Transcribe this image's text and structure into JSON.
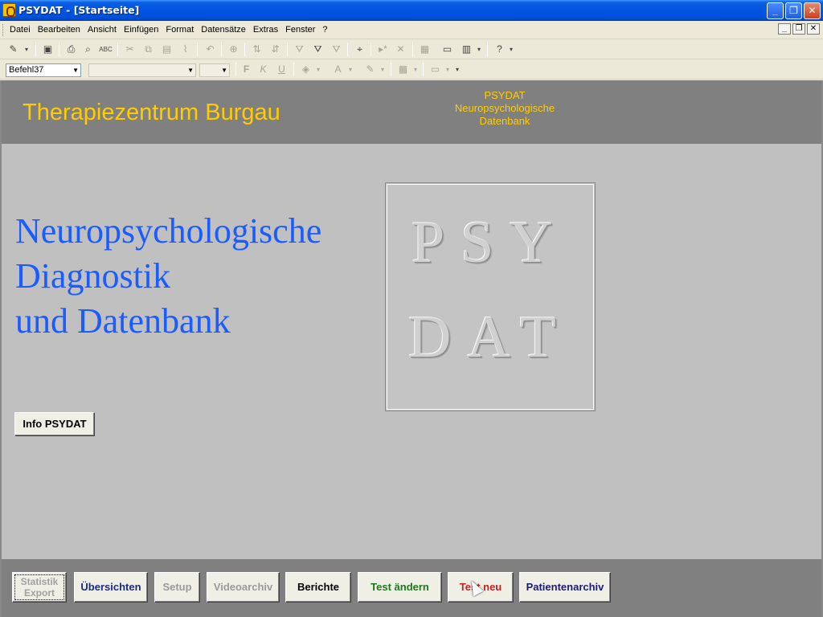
{
  "window": {
    "title": "PSYDAT - [Startseite]"
  },
  "menu": {
    "items": [
      "Datei",
      "Bearbeiten",
      "Ansicht",
      "Einfügen",
      "Format",
      "Datensätze",
      "Extras",
      "Fenster",
      "?"
    ]
  },
  "toolbar": {
    "object_combo": "Befehl37",
    "font_combo": "",
    "size_combo": "",
    "bold": "F",
    "italic": "K",
    "underline": "U"
  },
  "header": {
    "clinic_name": "Therapiezentrum Burgau",
    "subtitle": [
      "PSYDAT",
      "Neuropsychologische",
      "Datenbank"
    ]
  },
  "main": {
    "headline": [
      "Neuropsychologische",
      "Diagnostik",
      "und Datenbank"
    ],
    "logo": [
      "PSY",
      "DAT"
    ],
    "info_button": "Info PSYDAT"
  },
  "footer": {
    "buttons": [
      {
        "label": "Statistik Export",
        "enabled": false
      },
      {
        "label": "Übersichten",
        "enabled": true
      },
      {
        "label": "Setup",
        "enabled": false
      },
      {
        "label": "Videoarchiv",
        "enabled": false
      },
      {
        "label": "Berichte",
        "enabled": true
      },
      {
        "label": "Test ändern",
        "enabled": true
      },
      {
        "label": "Test neu",
        "enabled": true
      },
      {
        "label": "Patientenarchiv",
        "enabled": true
      }
    ]
  },
  "colors": {
    "accent_yellow": "#ffcc00",
    "headline_blue": "#1a5cff",
    "band_gray": "#808080",
    "form_gray": "#c0c0c0"
  }
}
